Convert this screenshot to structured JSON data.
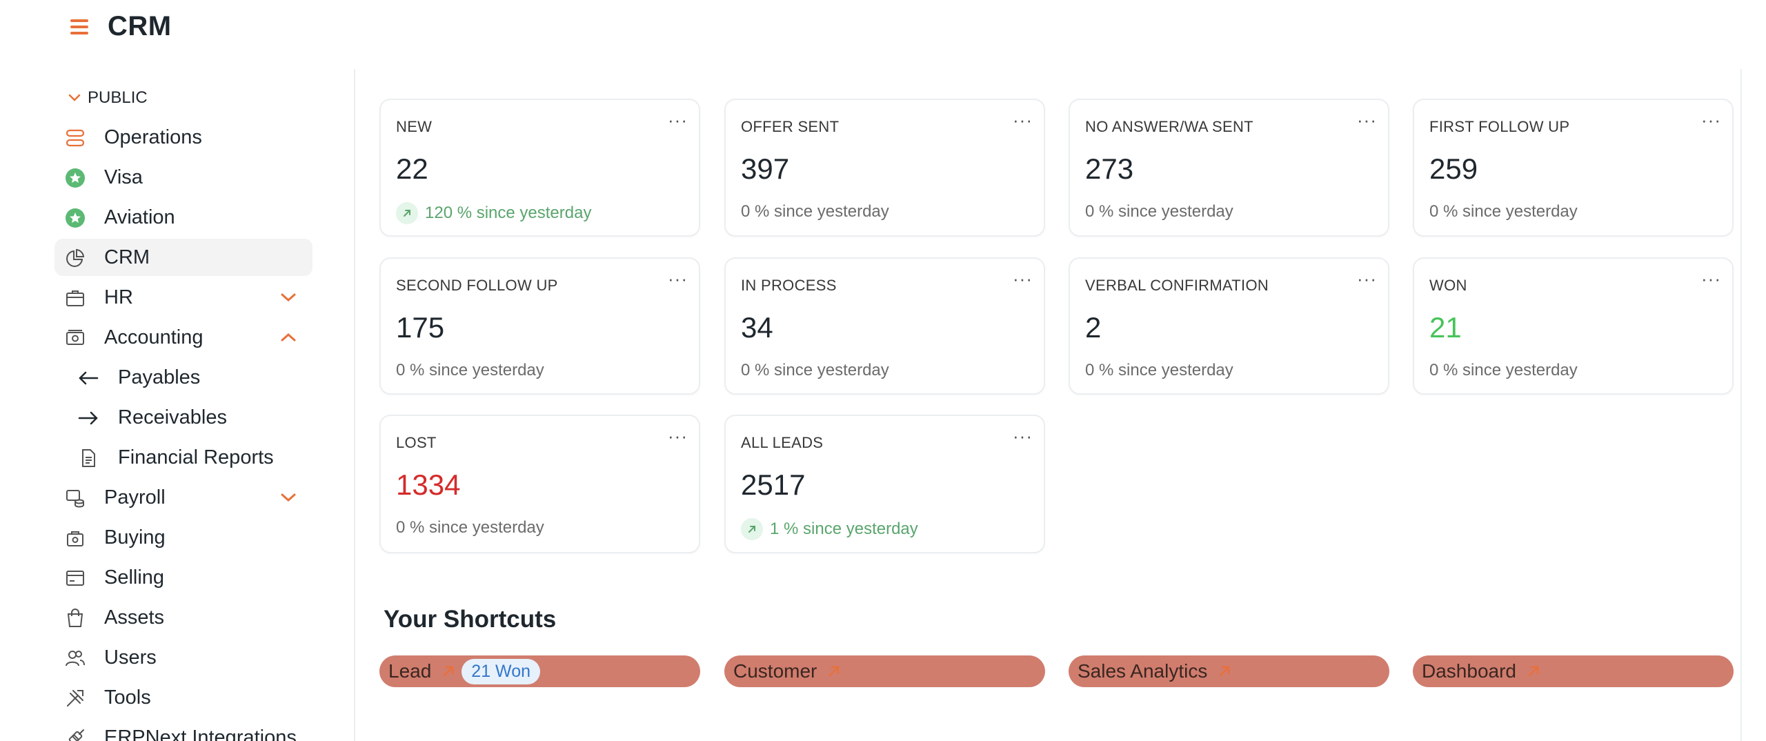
{
  "app": {
    "title": "CRM"
  },
  "sidebar": {
    "section_label": "PUBLIC",
    "items": [
      {
        "label": "Operations",
        "icon": "operations-icon"
      },
      {
        "label": "Visa",
        "icon": "star-badge-icon"
      },
      {
        "label": "Aviation",
        "icon": "star-badge-icon"
      },
      {
        "label": "CRM",
        "icon": "pie-chart-icon",
        "active": true
      },
      {
        "label": "HR",
        "icon": "briefcase-icon",
        "expandable": "collapsed"
      },
      {
        "label": "Accounting",
        "icon": "cash-icon",
        "expandable": "expanded"
      },
      {
        "label": "Payables",
        "icon": "arrow-left-icon"
      },
      {
        "label": "Receivables",
        "icon": "arrow-right-icon"
      },
      {
        "label": "Financial Reports",
        "icon": "document-icon"
      },
      {
        "label": "Payroll",
        "icon": "payroll-icon",
        "expandable": "collapsed"
      },
      {
        "label": "Buying",
        "icon": "buying-icon"
      },
      {
        "label": "Selling",
        "icon": "selling-icon"
      },
      {
        "label": "Assets",
        "icon": "assets-icon"
      },
      {
        "label": "Users",
        "icon": "users-icon"
      },
      {
        "label": "Tools",
        "icon": "tools-icon"
      },
      {
        "label": "ERPNext Integrations",
        "icon": "integrations-icon"
      }
    ]
  },
  "cards": [
    {
      "title": "NEW",
      "value": "22",
      "sub": "120 % since yesterday",
      "trend": "up"
    },
    {
      "title": "OFFER SENT",
      "value": "397",
      "sub": "0 % since yesterday"
    },
    {
      "title": "NO ANSWER/WA SENT",
      "value": "273",
      "sub": "0 % since yesterday"
    },
    {
      "title": "FIRST FOLLOW UP",
      "value": "259",
      "sub": "0 % since yesterday"
    },
    {
      "title": "SECOND FOLLOW UP",
      "value": "175",
      "sub": "0 % since yesterday"
    },
    {
      "title": "IN PROCESS",
      "value": "34",
      "sub": "0 % since yesterday"
    },
    {
      "title": "VERBAL CONFIRMATION",
      "value": "2",
      "sub": "0 % since yesterday"
    },
    {
      "title": "WON",
      "value": "21",
      "sub": "0 % since yesterday",
      "value_color": "green"
    },
    {
      "title": "LOST",
      "value": "1334",
      "sub": "0 % since yesterday",
      "value_color": "red"
    },
    {
      "title": "ALL LEADS",
      "value": "2517",
      "sub": "1 % since yesterday",
      "trend": "up"
    }
  ],
  "card_menu": "···",
  "shortcuts": {
    "title": "Your Shortcuts",
    "items": [
      {
        "label": "Lead",
        "badge": "21 Won"
      },
      {
        "label": "Customer"
      },
      {
        "label": "Sales Analytics"
      },
      {
        "label": "Dashboard"
      }
    ]
  },
  "colors": {
    "accent": "#e8703a",
    "shortcut_bg": "#d07d6e",
    "positive": "#47c459",
    "negative": "#d42b2b",
    "badge_text": "#3477c8"
  }
}
